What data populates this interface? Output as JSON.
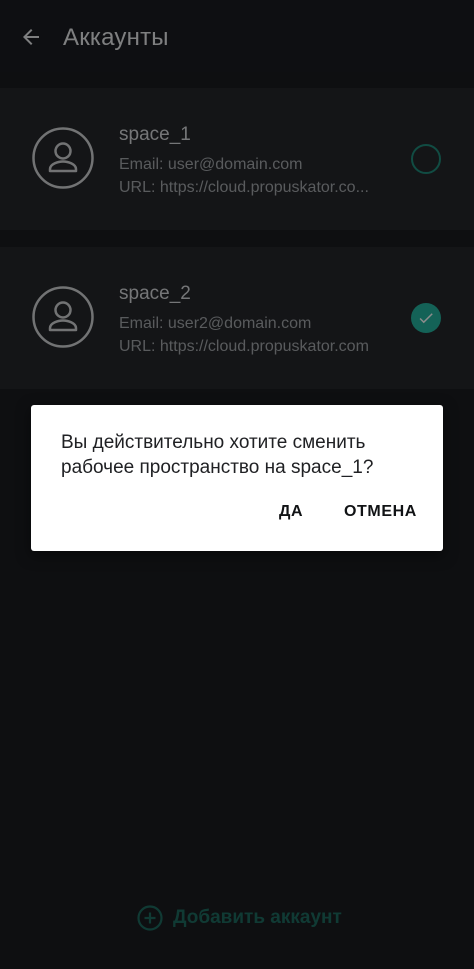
{
  "appbar": {
    "title": "Аккаунты",
    "back_icon": "arrow-left-icon"
  },
  "accounts": [
    {
      "name": "space_1",
      "email": "Email: user@domain.com",
      "url": "URL: https://cloud.propuskator.co...",
      "selected": false
    },
    {
      "name": "space_2",
      "email": "Email: user2@domain.com",
      "url": "URL: https://cloud.propuskator.com",
      "selected": true
    }
  ],
  "add_account": {
    "label": "Добавить аккаунт",
    "icon": "plus-circle-icon"
  },
  "dialog": {
    "message": "Вы действительно хотите сменить рабочее пространство на space_1?",
    "confirm_label": "ДА",
    "cancel_label": "ОТМЕНА"
  },
  "colors": {
    "accent": "#25b39e",
    "background": "#1b1d21",
    "card": "#25272b"
  }
}
